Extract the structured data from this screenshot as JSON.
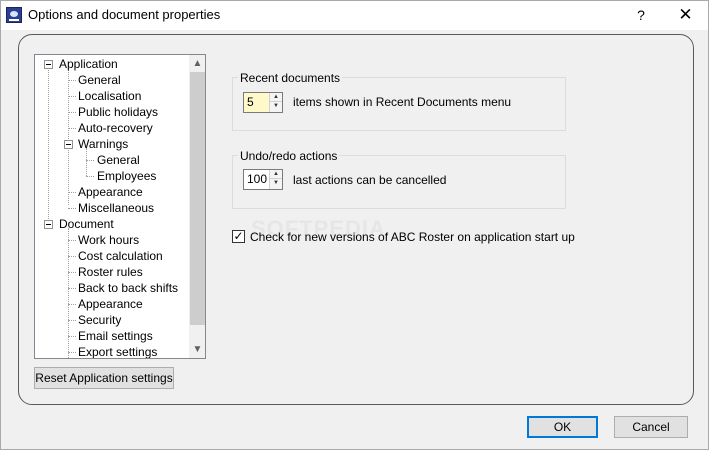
{
  "window": {
    "title": "Options and document properties",
    "help_label": "?",
    "close_label": "✕"
  },
  "tree": {
    "items": [
      {
        "label": "Application"
      },
      {
        "label": "General"
      },
      {
        "label": "Localisation"
      },
      {
        "label": "Public holidays"
      },
      {
        "label": "Auto-recovery"
      },
      {
        "label": "Warnings"
      },
      {
        "label": "General"
      },
      {
        "label": "Employees"
      },
      {
        "label": "Appearance"
      },
      {
        "label": "Miscellaneous"
      },
      {
        "label": "Document"
      },
      {
        "label": "Work hours"
      },
      {
        "label": "Cost calculation"
      },
      {
        "label": "Roster rules"
      },
      {
        "label": "Back to back shifts"
      },
      {
        "label": "Appearance"
      },
      {
        "label": "Security"
      },
      {
        "label": "Email settings"
      },
      {
        "label": "Export settings"
      }
    ],
    "scroll_up": "▲",
    "scroll_down": "▼"
  },
  "reset_button": "Reset Application settings",
  "recent_documents": {
    "group_label": "Recent documents",
    "value": "5",
    "description": "items shown in Recent Documents menu"
  },
  "undo_redo": {
    "group_label": "Undo/redo actions",
    "value": "100",
    "description": "last actions can be cancelled"
  },
  "check_updates": {
    "label": "Check for new versions of ABC Roster on application start up",
    "checked": true,
    "mark": "✓"
  },
  "watermark": "SOFTPEDIA",
  "buttons": {
    "ok": "OK",
    "cancel": "Cancel"
  },
  "spinner": {
    "up": "▲",
    "down": "▼"
  }
}
